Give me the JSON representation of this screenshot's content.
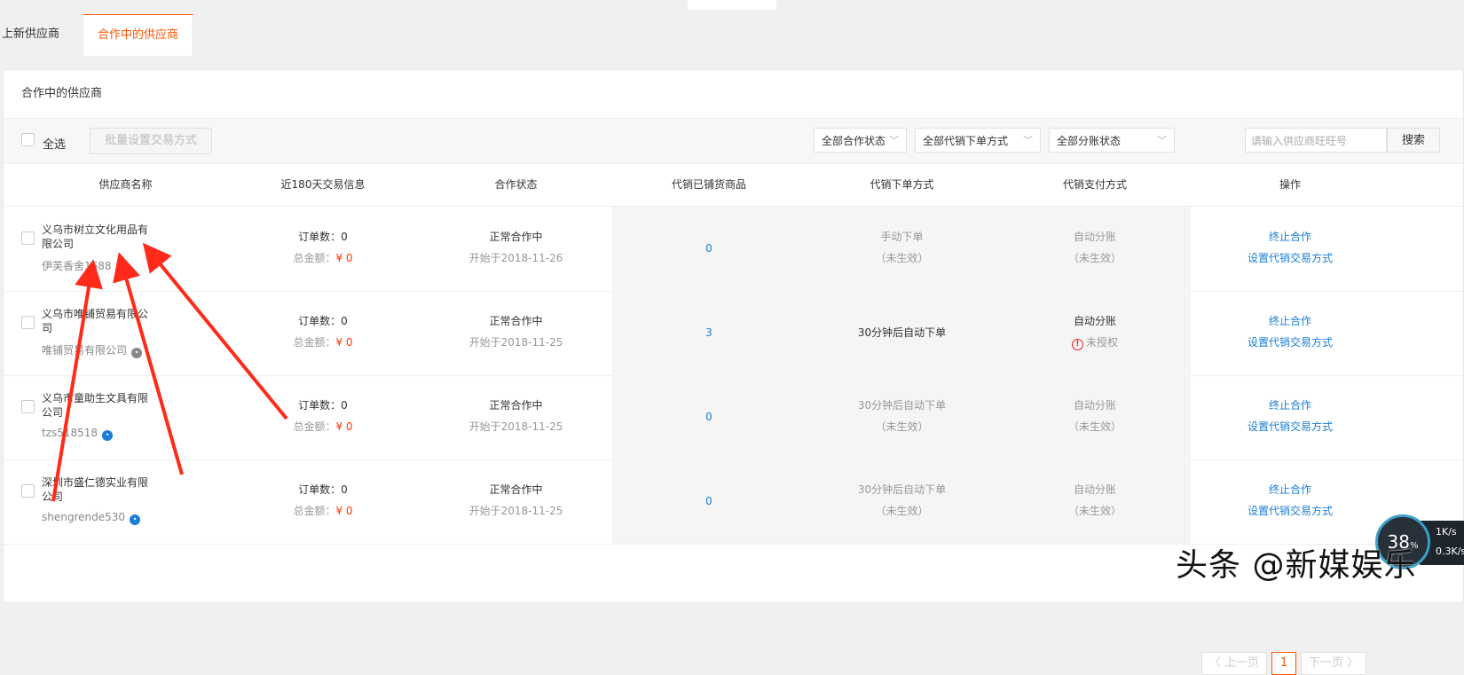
{
  "tabs": {
    "new_suppliers": "上新供应商",
    "cooperating_suppliers": "合作中的供应商"
  },
  "panel_title": "合作中的供应商",
  "filters": {
    "select_all": "全选",
    "batch_button": "批量设置交易方式",
    "cooperation_status": "全部合作状态",
    "order_method": "全部代销下单方式",
    "split_status": "全部分账状态",
    "search_placeholder": "请输入供应商旺旺号",
    "search_button": "搜索"
  },
  "table": {
    "headers": [
      "供应商名称",
      "近180天交易信息",
      "合作状态",
      "代销已铺货商品",
      "代销下单方式",
      "代销支付方式",
      "操作"
    ],
    "rows": [
      {
        "name": "义乌市树立文化用品有限公司",
        "wangwang": "伊芙香舍1688",
        "wang_icon_color": "#888888",
        "orders": "订单数：0",
        "amount_label": "总金额：",
        "amount": "¥ 0",
        "status": "正常合作中",
        "since": "开始于2018-11-26",
        "goods": "0",
        "order_method": "手动下单",
        "order_method_note": "（未生效）",
        "order_method_active": false,
        "payment": "自动分账",
        "payment_note": "（未生效）",
        "payment_active": false,
        "payment_warning": false,
        "action_terminate": "终止合作",
        "action_set": "设置代销交易方式"
      },
      {
        "name": "义乌市唯铺贸易有限公司",
        "wangwang": "唯铺贸易有限公司",
        "wang_icon_color": "#888888",
        "orders": "订单数：0",
        "amount_label": "总金额：",
        "amount": "¥ 0",
        "status": "正常合作中",
        "since": "开始于2018-11-25",
        "goods": "3",
        "order_method": "30分钟后自动下单",
        "order_method_note": "",
        "order_method_active": true,
        "payment": "自动分账",
        "payment_note": "未授权",
        "payment_active": true,
        "payment_warning": true,
        "action_terminate": "终止合作",
        "action_set": "设置代销交易方式"
      },
      {
        "name": "义乌市童助生文具有限公司",
        "wangwang": "tzs518518",
        "wang_icon_color": "#1a7ed8",
        "orders": "订单数：0",
        "amount_label": "总金额：",
        "amount": "¥ 0",
        "status": "正常合作中",
        "since": "开始于2018-11-25",
        "goods": "0",
        "order_method": "30分钟后自动下单",
        "order_method_note": "（未生效）",
        "order_method_active": false,
        "payment": "自动分账",
        "payment_note": "（未生效）",
        "payment_active": false,
        "payment_warning": false,
        "action_terminate": "终止合作",
        "action_set": "设置代销交易方式"
      },
      {
        "name": "深圳市盛仁德实业有限公司",
        "wangwang": "shengrende530",
        "wang_icon_color": "#1a7ed8",
        "orders": "订单数：0",
        "amount_label": "总金额：",
        "amount": "¥ 0",
        "status": "正常合作中",
        "since": "开始于2018-11-25",
        "goods": "0",
        "order_method": "30分钟后自动下单",
        "order_method_note": "（未生效）",
        "order_method_active": false,
        "payment": "自动分账",
        "payment_note": "（未生效）",
        "payment_active": false,
        "payment_warning": false,
        "action_terminate": "终止合作",
        "action_set": "设置代销交易方式"
      }
    ]
  },
  "pagination": {
    "prev": "〈 上一页",
    "current": "1",
    "next": "下一页 〉"
  },
  "watermark": "头条 @新媒娱乐",
  "speed_widget": {
    "percent": "38",
    "up": "1K/s",
    "down": "0.3K/s"
  },
  "colors": {
    "accent": "#ff5500",
    "link": "#1a7ed8",
    "amount": "#ff3300",
    "annotation_arrow": "#ff2a1a"
  }
}
